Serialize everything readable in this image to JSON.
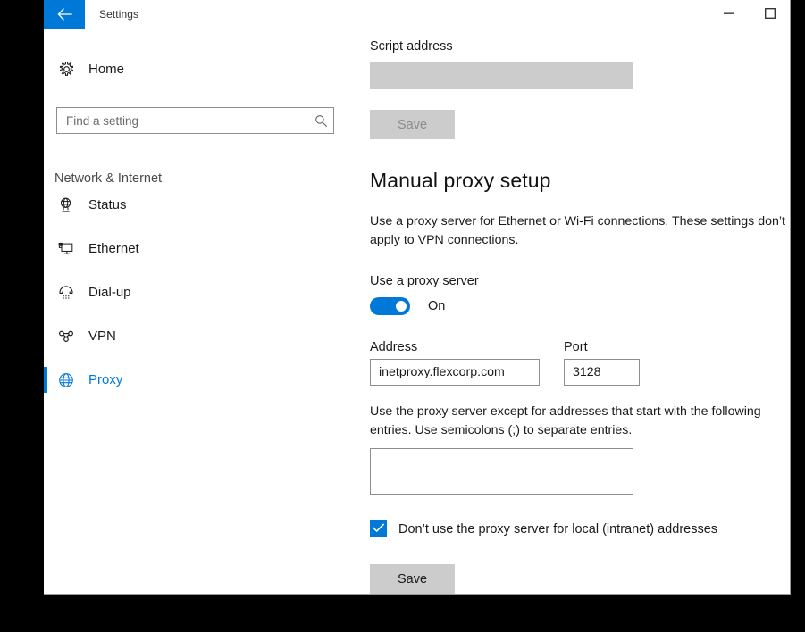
{
  "window": {
    "title": "Settings",
    "back_icon": "back-arrow-icon",
    "minimize_label": "—",
    "maximize_label": "☐",
    "accent_color": "#0078d7"
  },
  "sidebar": {
    "home": {
      "label": "Home",
      "icon": "gear-icon"
    },
    "search": {
      "placeholder": "Find a setting",
      "value": "",
      "icon": "search-icon"
    },
    "category": "Network & Internet",
    "items": [
      {
        "label": "Status",
        "icon": "globe-monitor-icon",
        "selected": false
      },
      {
        "label": "Ethernet",
        "icon": "ethernet-monitor-icon",
        "selected": false
      },
      {
        "label": "Dial-up",
        "icon": "telephone-icon",
        "selected": false
      },
      {
        "label": "VPN",
        "icon": "vpn-nodes-icon",
        "selected": false
      },
      {
        "label": "Proxy",
        "icon": "globe-icon",
        "selected": true
      }
    ]
  },
  "main": {
    "script_address": {
      "label": "Script address",
      "value": "",
      "disabled": true
    },
    "script_save": {
      "label": "Save",
      "disabled": true
    },
    "section": {
      "title": "Manual proxy setup",
      "description": "Use a proxy server for Ethernet or Wi-Fi connections. These settings don’t apply to VPN connections."
    },
    "use_proxy": {
      "label": "Use a proxy server",
      "state": "On",
      "checked": true
    },
    "address": {
      "label": "Address",
      "value": "inetproxy.flexcorp.com"
    },
    "port": {
      "label": "Port",
      "value": "3128"
    },
    "exceptions": {
      "description": "Use the proxy server except for addresses that start with the following entries. Use semicolons (;) to separate entries.",
      "value": "",
      "placeholder": ""
    },
    "bypass_local": {
      "label": "Don’t use the proxy server for local (intranet) addresses",
      "checked": true,
      "icon": "checkmark-icon"
    },
    "save": {
      "label": "Save",
      "disabled": false
    }
  }
}
